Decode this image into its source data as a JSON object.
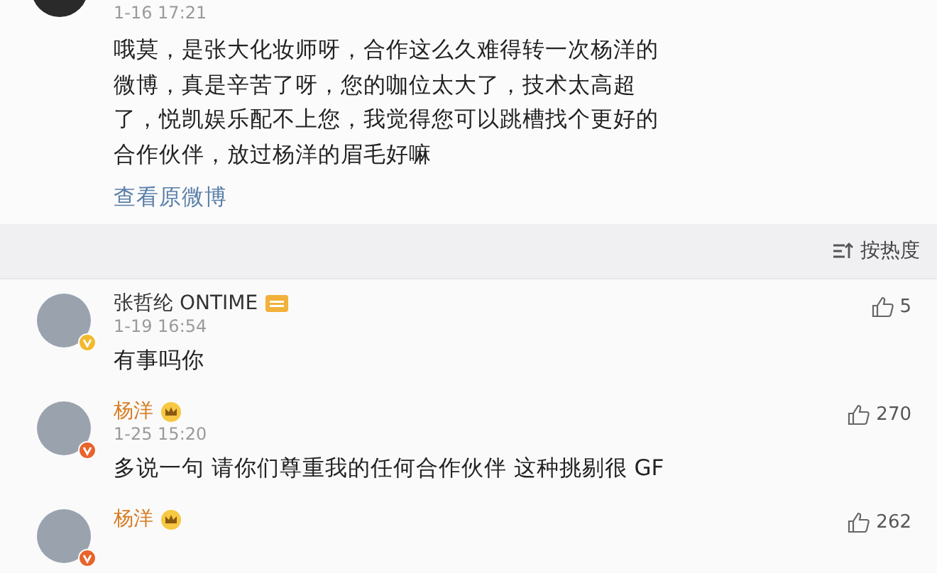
{
  "post": {
    "date": "1-16 17:21",
    "lines": [
      "哦莫，是张大化妆师呀，合作这么久难得转一次杨洋的",
      "微博，真是辛苦了呀，您的咖位太大了，技术太高超",
      "了，悦凯娱乐配不上您，我觉得您可以跳槽找个更好的",
      "合作伙伴，放过杨洋的眉毛好嘛"
    ],
    "link": "查看原微博"
  },
  "sort": {
    "label": "按热度"
  },
  "comments": [
    {
      "name": "张哲纶 ONTIME",
      "kind": "tag",
      "color": "#f2b92c",
      "date": "1-19 16:54",
      "text": "有事吗你",
      "likes": "5"
    },
    {
      "name": "杨洋",
      "kind": "crown",
      "color": "#e8642c",
      "date": "1-25 15:20",
      "text": "多说一句 请你们尊重我的任何合作伙伴 这种挑剔很 GF",
      "likes": "270"
    },
    {
      "name": "杨洋",
      "kind": "crown",
      "color": "#e8642c",
      "likes": "262"
    }
  ]
}
